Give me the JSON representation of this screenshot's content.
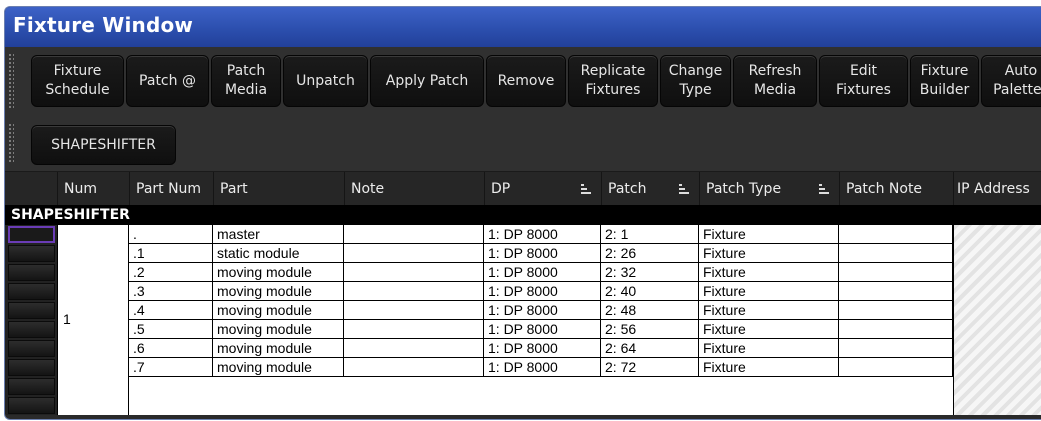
{
  "window": {
    "title": "Fixture Window"
  },
  "toolbar": {
    "row1": [
      "Fixture\nSchedule",
      "Patch @",
      "Patch\nMedia",
      "Unpatch",
      "Apply Patch",
      "Remove",
      "Replicate\nFixtures",
      "Change\nType",
      "Refresh\nMedia",
      "Edit\nFixtures",
      "Fixture\nBuilder",
      "Auto\nPalettes"
    ],
    "row2": [
      "SHAPESHIFTER"
    ]
  },
  "columns": [
    "Num",
    "Part Num",
    "Part",
    "Note",
    "DP",
    "Patch",
    "Patch Type",
    "Patch Note",
    "IP Address"
  ],
  "group": {
    "name": "SHAPESHIFTER",
    "num": "1"
  },
  "rows": [
    {
      "part_num": ".",
      "part": "master",
      "note": "",
      "dp": "1: DP 8000",
      "patch": "2: 1",
      "patch_type": "Fixture",
      "patch_note": ""
    },
    {
      "part_num": ".1",
      "part": "static module",
      "note": "",
      "dp": "1: DP 8000",
      "patch": "2: 26",
      "patch_type": "Fixture",
      "patch_note": ""
    },
    {
      "part_num": ".2",
      "part": "moving module",
      "note": "",
      "dp": "1: DP 8000",
      "patch": "2: 32",
      "patch_type": "Fixture",
      "patch_note": ""
    },
    {
      "part_num": ".3",
      "part": "moving module",
      "note": "",
      "dp": "1: DP 8000",
      "patch": "2: 40",
      "patch_type": "Fixture",
      "patch_note": ""
    },
    {
      "part_num": ".4",
      "part": "moving module",
      "note": "",
      "dp": "1: DP 8000",
      "patch": "2: 48",
      "patch_type": "Fixture",
      "patch_note": ""
    },
    {
      "part_num": ".5",
      "part": "moving module",
      "note": "",
      "dp": "1: DP 8000",
      "patch": "2: 56",
      "patch_type": "Fixture",
      "patch_note": ""
    },
    {
      "part_num": ".6",
      "part": "moving module",
      "note": "",
      "dp": "1: DP 8000",
      "patch": "2: 64",
      "patch_type": "Fixture",
      "patch_note": ""
    },
    {
      "part_num": ".7",
      "part": "moving module",
      "note": "",
      "dp": "1: DP 8000",
      "patch": "2: 72",
      "patch_type": "Fixture",
      "patch_note": ""
    }
  ],
  "colors": {
    "title_bar": "#2c4fae",
    "selection_outline": "#6a3cb6",
    "toolbar_bg": "#303030"
  }
}
